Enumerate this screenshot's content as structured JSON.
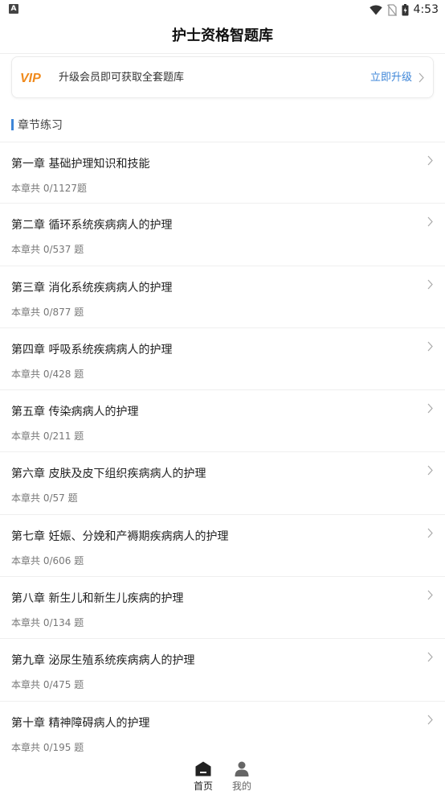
{
  "status_bar": {
    "left_badge": "A",
    "time": "4:53",
    "icons": [
      "wifi-icon",
      "no-sim-icon",
      "battery-icon"
    ]
  },
  "header": {
    "title": "护士资格智题库"
  },
  "vip_banner": {
    "logo_text": "VIP",
    "message": "升级会员即可获取全套题库",
    "upgrade_label": "立即升级",
    "accent_color": "#f08a1c",
    "link_color": "#3e86d8"
  },
  "section": {
    "title": "章节练习"
  },
  "chapters": [
    {
      "title": "第一章 基础护理知识和技能",
      "count": "本章共 0/1127题"
    },
    {
      "title": "第二章 循环系统疾病病人的护理",
      "count": "本章共 0/537 题"
    },
    {
      "title": "第三章 消化系统疾病病人的护理",
      "count": "本章共 0/877 题"
    },
    {
      "title": "第四章 呼吸系统疾病病人的护理",
      "count": "本章共 0/428 题"
    },
    {
      "title": "第五章 传染病病人的护理",
      "count": "本章共 0/211 题"
    },
    {
      "title": "第六章 皮肤及皮下组织疾病病人的护理",
      "count": "本章共 0/57 题"
    },
    {
      "title": "第七章 妊娠、分娩和产褥期疾病病人的护理",
      "count": "本章共 0/606 题"
    },
    {
      "title": "第八章 新生儿和新生儿疾病的护理",
      "count": "本章共 0/134 题"
    },
    {
      "title": "第九章 泌尿生殖系统疾病病人的护理",
      "count": "本章共 0/475 题"
    },
    {
      "title": "第十章 精神障碍病人的护理",
      "count": "本章共 0/195 题"
    }
  ],
  "tab_bar": {
    "home_label": "首页",
    "me_label": "我的",
    "active": "home"
  }
}
